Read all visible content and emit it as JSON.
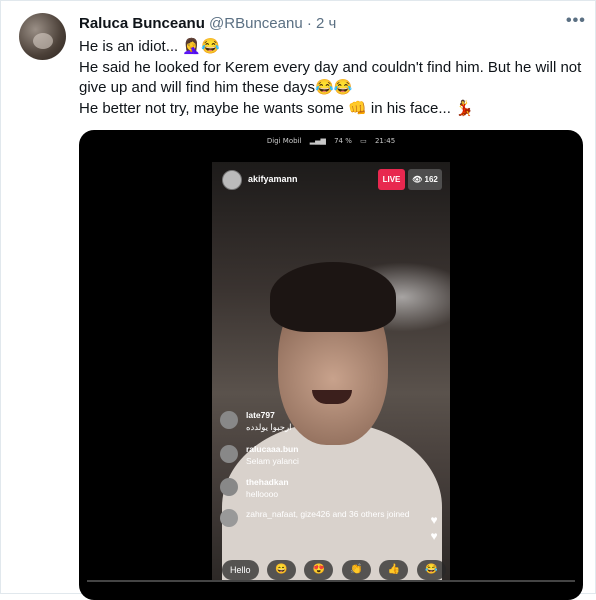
{
  "tweet": {
    "author_name": "Raluca Bunceanu",
    "author_handle": "@RBunceanu",
    "time": "· 2 ч",
    "more_icon": "more-horizontal-icon",
    "lines": [
      "He is an idiot... 🤦‍♀️😂",
      "He said he looked for Kerem every day and couldn't find him. But he will not give up and will find him these days😂😂",
      "He better not try, maybe he wants some 👊 in his face... 💃"
    ]
  },
  "video": {
    "status_bar": {
      "carrier": "Digi Mobil",
      "battery": "74 %",
      "time": "21:45"
    },
    "live_username": "akifyamann",
    "live_badge": "LIVE",
    "viewer_count": "162",
    "comments": [
      {
        "user": "late797",
        "message": "ارجبوا يولدده"
      },
      {
        "user": "ralucaaa.bun",
        "message": "Selam yalanci"
      },
      {
        "user": "thehadkan",
        "message": "helloooo"
      }
    ],
    "joined_text": "zahra_nafaat, gize426 and 36 others joined",
    "reply_placeholder": "Hello",
    "reactions": [
      "😄",
      "😍",
      "👏",
      "👍",
      "😂"
    ]
  },
  "colors": {
    "live_badge": "#e8284f",
    "handle_gray": "#5b7083",
    "video_bg": "#000000"
  }
}
